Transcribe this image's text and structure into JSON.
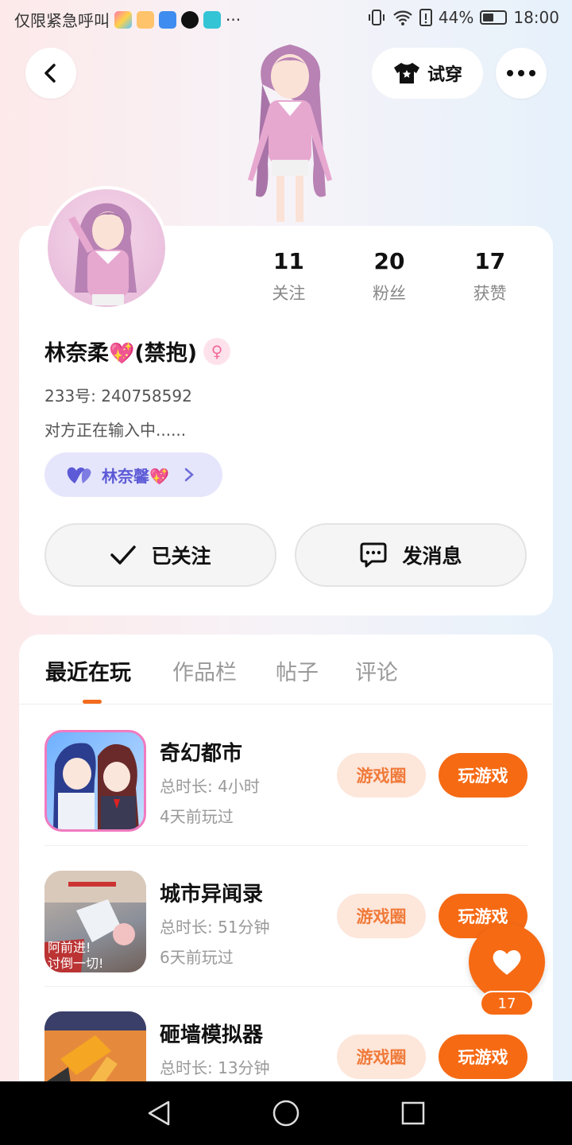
{
  "status_bar": {
    "carrier_text": "仅限紧急呼叫",
    "more_apps": "···",
    "battery": "44%",
    "time": "18:00"
  },
  "header": {
    "tryon_label": "试穿"
  },
  "profile": {
    "stats": [
      {
        "value": "11",
        "label": "关注"
      },
      {
        "value": "20",
        "label": "粉丝"
      },
      {
        "value": "17",
        "label": "获赞"
      }
    ],
    "name_prefix": "林奈柔",
    "name_heart": "💖",
    "name_suffix": "(禁抱)",
    "gender_symbol": "♀",
    "uid": "233号: 240758592",
    "bio": "对方正在输入中......",
    "relation_name": "林奈馨",
    "relation_heart": "💖",
    "follow_label": "已关注",
    "message_label": "发消息"
  },
  "tabs": [
    "最近在玩",
    "作品栏",
    "帖子",
    "评论"
  ],
  "games": [
    {
      "title": "奇幻都市",
      "duration": "总时长: 4小时",
      "last_played": "4天前玩过",
      "circle_label": "游戏圈",
      "play_label": "玩游戏"
    },
    {
      "title": "城市异闻录",
      "duration": "总时长: 51分钟",
      "last_played": "6天前玩过",
      "circle_label": "游戏圈",
      "play_label": "玩游戏"
    },
    {
      "title": "砸墙模拟器",
      "duration": "总时长: 13分钟",
      "last_played": "",
      "circle_label": "游戏圈",
      "play_label": "玩游戏"
    }
  ],
  "floating_like": {
    "count": "17"
  },
  "colors": {
    "accent_orange": "#f66a14",
    "pill_bg": "#fde6da",
    "relation_bg": "#e5e6fb"
  }
}
